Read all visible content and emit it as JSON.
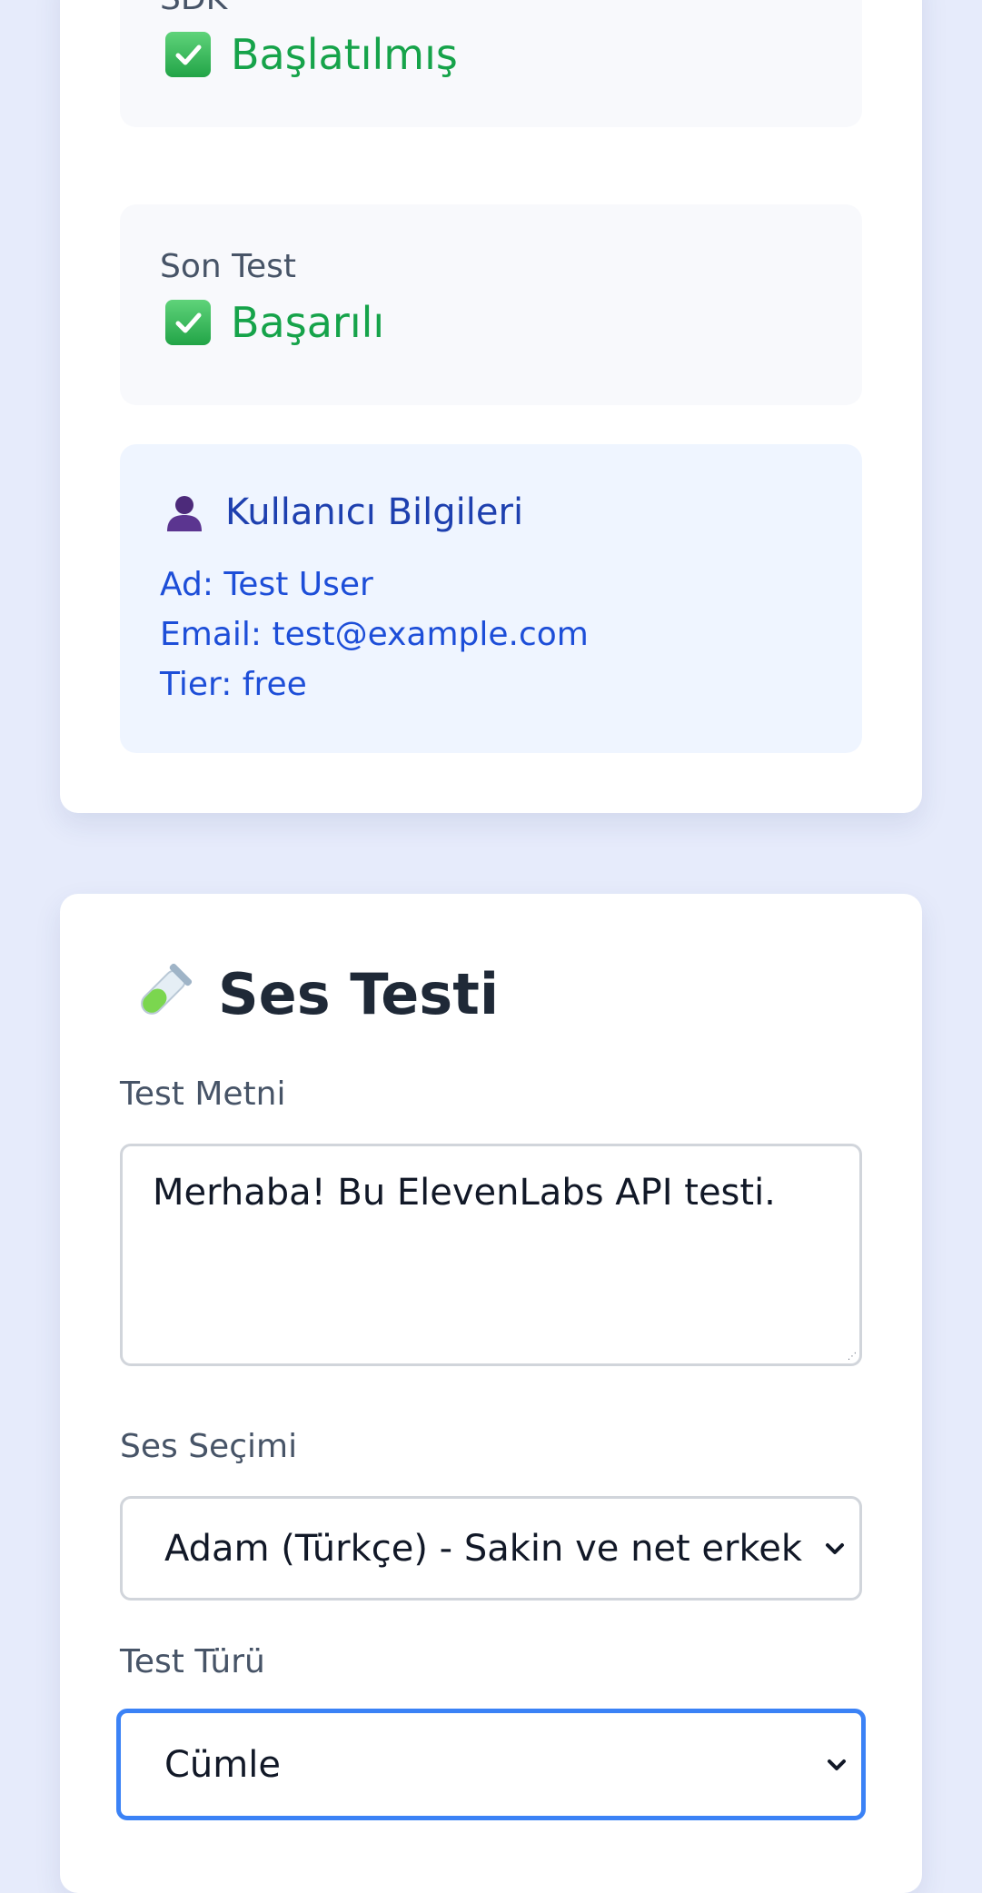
{
  "status": {
    "sdk": {
      "label": "SDK",
      "value": "Başlatılmış"
    },
    "last_test": {
      "label": "Son Test",
      "value": "Başarılı"
    }
  },
  "user_info": {
    "title": "Kullanıcı Bilgileri",
    "name_line": "Ad: Test User",
    "email_line": "Email: test@example.com",
    "tier_line": "Tier: free"
  },
  "sound_test": {
    "title": "Ses Testi",
    "text_label": "Test Metni",
    "text_value": "Merhaba! Bu ElevenLabs API testi.",
    "voice_label": "Ses Seçimi",
    "voice_value": "Adam (Türkçe) - Sakin ve net erkek",
    "type_label": "Test Türü",
    "type_value": "Cümle"
  },
  "icons": {
    "check": "check-mark-button-icon",
    "user": "bust-silhouette-icon",
    "tube": "test-tube-icon",
    "chevron": "chevron-down-icon"
  },
  "colors": {
    "success": "#16a34a",
    "info_text": "#1d4ed8",
    "focus_ring": "#3b82f6",
    "page_bg": "#e6ebfb"
  }
}
